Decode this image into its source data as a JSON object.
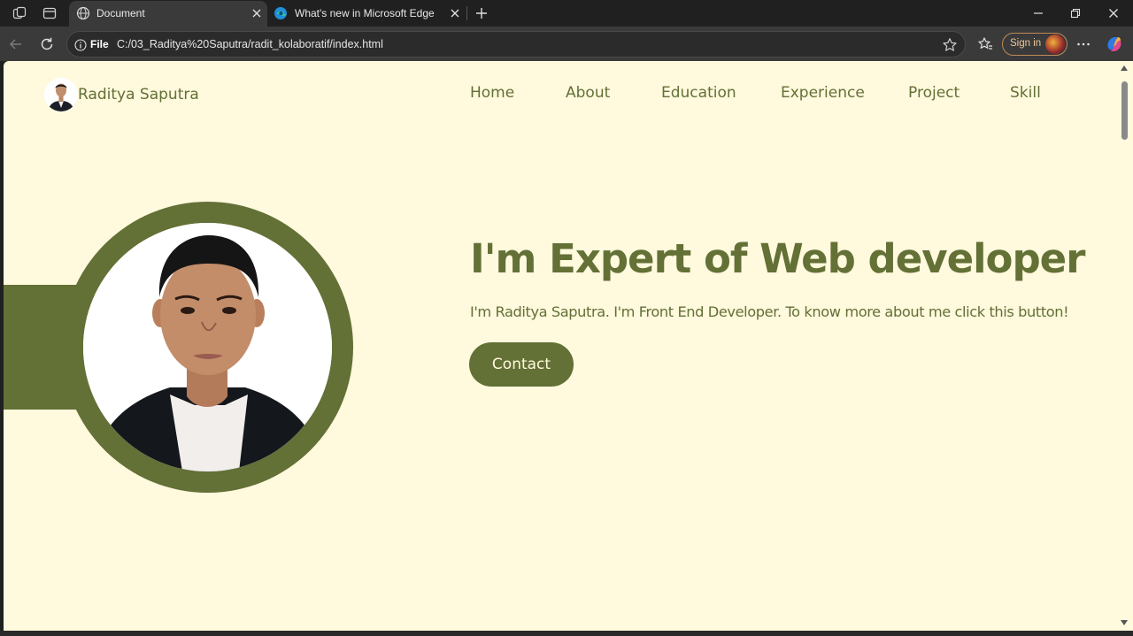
{
  "browser": {
    "tabs": [
      {
        "title": "Document",
        "icon": "globe-icon",
        "active": true
      },
      {
        "title": "What's new in Microsoft Edge",
        "icon": "edge-icon",
        "active": false
      }
    ],
    "address": {
      "scheme_label": "File",
      "url": "C:/03_Raditya%20Saputra/radit_kolaboratif/index.html"
    },
    "signin_label": "Sign in"
  },
  "page": {
    "brand_name": "Raditya Saputra",
    "nav": [
      "Home",
      "About",
      "Education",
      "Experience",
      "Project",
      "Skill"
    ],
    "hero": {
      "headline": "I'm Expert of Web developer",
      "subline": "I'm Raditya Saputra. I'm Front End Developer. To know more about me click this button!",
      "cta_label": "Contact"
    },
    "colors": {
      "accent": "#637036",
      "background": "#fff9dd"
    }
  }
}
